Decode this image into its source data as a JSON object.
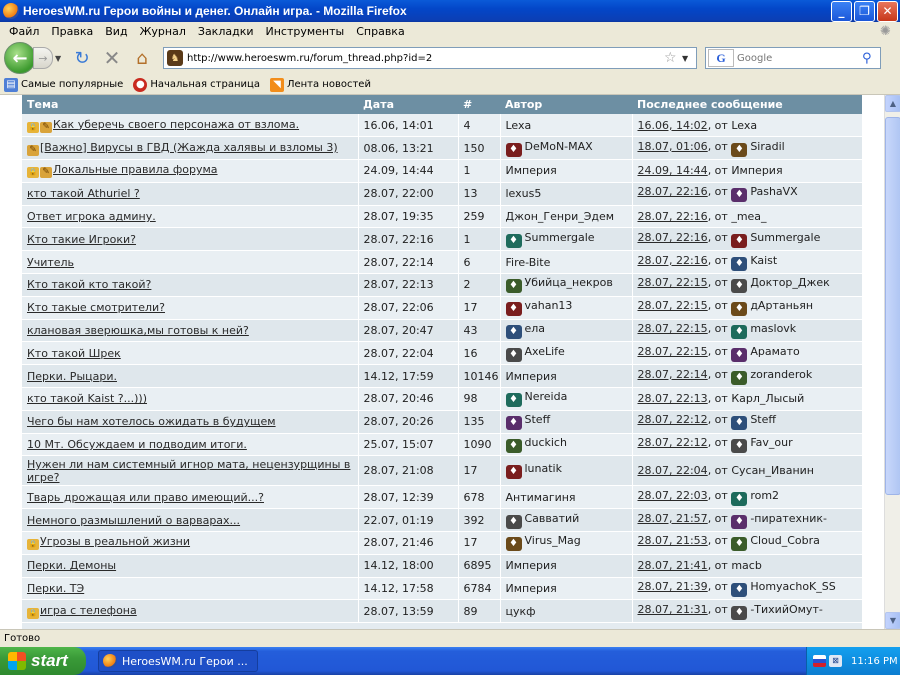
{
  "window": {
    "title": "HeroesWM.ru Герои войны и денег. Онлайн игра. - Mozilla Firefox",
    "minimize": "_",
    "maximize": "❐",
    "close": "✕"
  },
  "menu": [
    "Файл",
    "Правка",
    "Вид",
    "Журнал",
    "Закладки",
    "Инструменты",
    "Справка"
  ],
  "nav": {
    "url": "http://www.heroeswm.ru/forum_thread.php?id=2",
    "search_placeholder": "Google",
    "search_engine": "G"
  },
  "bookmarks": [
    "Самые популярные",
    "Начальная страница",
    "Лента новостей"
  ],
  "table": {
    "headers": [
      "Тема",
      "Дата",
      "#",
      "Автор",
      "Последнее сообщение"
    ],
    "rows": [
      {
        "topic": "Как уберечь своего персонажа от взлома.",
        "icon": "lock-pin",
        "date": "16.06, 14:01",
        "count": "4",
        "author": "Lexa",
        "author_icon": "",
        "last_date": "16.06, 14:02",
        "last_sep": ", от ",
        "last_author": "Lexa",
        "last_icon": ""
      },
      {
        "topic": "[Важно] Вирусы в ГВД (Жажда халявы и взломы 3)",
        "icon": "pin",
        "date": "08.06, 13:21",
        "count": "150",
        "author": "DeMoN-MAX",
        "author_icon": "clan",
        "last_date": "18.07, 01:06",
        "last_sep": ", от ",
        "last_author": "Siradil",
        "last_icon": "clan"
      },
      {
        "topic": "Локальные правила форума",
        "icon": "lock-pin",
        "date": "24.09, 14:44",
        "count": "1",
        "author": "Империя",
        "author_icon": "",
        "last_date": "24.09, 14:44",
        "last_sep": ", от ",
        "last_author": "Империя",
        "last_icon": ""
      },
      {
        "topic": "кто такой Athuriel ?",
        "icon": "",
        "date": "28.07, 22:00",
        "count": "13",
        "author": "lexus5",
        "author_icon": "",
        "last_date": "28.07, 22:16",
        "last_sep": ", от ",
        "last_author": "PashaVX",
        "last_icon": "clan"
      },
      {
        "topic": "Ответ игрока админу.",
        "icon": "",
        "date": "28.07, 19:35",
        "count": "259",
        "author": "Джон_Генри_Эдем",
        "author_icon": "",
        "last_date": "28.07, 22:16",
        "last_sep": ", от ",
        "last_author": "_mea_",
        "last_icon": ""
      },
      {
        "topic": "Кто такие Игроки?",
        "icon": "",
        "date": "28.07, 22:16",
        "count": "1",
        "author": "Summergale",
        "author_icon": "clan",
        "last_date": "28.07, 22:16",
        "last_sep": ", от ",
        "last_author": "Summergale",
        "last_icon": "clan"
      },
      {
        "topic": "Учитель",
        "icon": "",
        "date": "28.07, 22:14",
        "count": "6",
        "author": "Fire-Bite",
        "author_icon": "",
        "last_date": "28.07, 22:16",
        "last_sep": ", от ",
        "last_author": "Kaist",
        "last_icon": "clan"
      },
      {
        "topic": "Кто такой кто такой?",
        "icon": "",
        "date": "28.07, 22:13",
        "count": "2",
        "author": "Убийца_некров",
        "author_icon": "clan",
        "last_date": "28.07, 22:15",
        "last_sep": ", от ",
        "last_author": "Доктор_Джек",
        "last_icon": "clan"
      },
      {
        "topic": "Кто такые смотрители?",
        "icon": "",
        "date": "28.07, 22:06",
        "count": "17",
        "author": "vahan13",
        "author_icon": "clan",
        "last_date": "28.07, 22:15",
        "last_sep": ", от ",
        "last_author": "дАртаньян",
        "last_icon": "clan"
      },
      {
        "topic": "клановая зверюшка,мы готовы к ней?",
        "icon": "",
        "date": "28.07, 20:47",
        "count": "43",
        "author": "ела",
        "author_icon": "clan",
        "last_date": "28.07, 22:15",
        "last_sep": ", от ",
        "last_author": "maslovk",
        "last_icon": "clan"
      },
      {
        "topic": "Кто такой Шрек",
        "icon": "",
        "date": "28.07, 22:04",
        "count": "16",
        "author": "AxeLife",
        "author_icon": "clan",
        "last_date": "28.07, 22:15",
        "last_sep": ", от ",
        "last_author": "Арамато",
        "last_icon": "clan"
      },
      {
        "topic": "Перки. Рыцари.",
        "icon": "",
        "date": "14.12, 17:59",
        "count": "10146",
        "author": "Империя",
        "author_icon": "",
        "last_date": "28.07, 22:14",
        "last_sep": ", от ",
        "last_author": "zoranderok",
        "last_icon": "clan"
      },
      {
        "topic": "кто такой Kaist ?...)))",
        "icon": "",
        "date": "28.07, 20:46",
        "count": "98",
        "author": "Nereida",
        "author_icon": "clan",
        "last_date": "28.07, 22:13",
        "last_sep": ", от ",
        "last_author": "Карл_Лысый",
        "last_icon": ""
      },
      {
        "topic": "Чего бы нам хотелось ожидать в будущем",
        "icon": "",
        "date": "28.07, 20:26",
        "count": "135",
        "author": "Steff",
        "author_icon": "clan",
        "last_date": "28.07, 22:12",
        "last_sep": ", от ",
        "last_author": "Steff",
        "last_icon": "clan"
      },
      {
        "topic": "10 Мт. Обсуждаем и подводим итоги.",
        "icon": "",
        "date": "25.07, 15:07",
        "count": "1090",
        "author": "duckich",
        "author_icon": "clan",
        "last_date": "28.07, 22:12",
        "last_sep": ", от ",
        "last_author": "Fav_our",
        "last_icon": "clan"
      },
      {
        "topic": "Нужен ли нам системный игнор мата, нецензурщины в игре?",
        "icon": "",
        "date": "28.07, 21:08",
        "count": "17",
        "author": "lunatik",
        "author_icon": "clan",
        "last_date": "28.07, 22:04",
        "last_sep": ", от ",
        "last_author": "Сусан_Иванин",
        "last_icon": ""
      },
      {
        "topic": "Тварь дрожащая или право имеющий...?",
        "icon": "",
        "date": "28.07, 12:39",
        "count": "678",
        "author": "Антимагиня",
        "author_icon": "",
        "last_date": "28.07, 22:03",
        "last_sep": ", от ",
        "last_author": "rom2",
        "last_icon": "clan"
      },
      {
        "topic": "Немного размышлений о варварах...",
        "icon": "",
        "date": "22.07, 01:19",
        "count": "392",
        "author": "Савватий",
        "author_icon": "clan",
        "last_date": "28.07, 21:57",
        "last_sep": ", от ",
        "last_author": "-пиратехник-",
        "last_icon": "clan"
      },
      {
        "topic": "Угрозы в реальной жизни",
        "icon": "lock",
        "date": "28.07, 21:46",
        "count": "17",
        "author": "Virus_Mag",
        "author_icon": "clan",
        "last_date": "28.07, 21:53",
        "last_sep": ", от ",
        "last_author": "Cloud_Cobra",
        "last_icon": "clan"
      },
      {
        "topic": "Перки. Демоны",
        "icon": "",
        "date": "14.12, 18:00",
        "count": "6895",
        "author": "Империя",
        "author_icon": "",
        "last_date": "28.07, 21:41",
        "last_sep": ", от ",
        "last_author": "macb",
        "last_icon": ""
      },
      {
        "topic": "Перки. ТЭ",
        "icon": "",
        "date": "14.12, 17:58",
        "count": "6784",
        "author": "Империя",
        "author_icon": "",
        "last_date": "28.07, 21:39",
        "last_sep": ", от ",
        "last_author": "HomyachoK_SS",
        "last_icon": "clan"
      },
      {
        "topic": "игра с телефона",
        "icon": "lock",
        "date": "28.07, 13:59",
        "count": "89",
        "author": "цукф",
        "author_icon": "",
        "last_date": "28.07, 21:31",
        "last_sep": ", от ",
        "last_author": "-ТихийОмут-",
        "last_icon": "clan"
      }
    ]
  },
  "status": "Готово",
  "taskbar": {
    "start": "start",
    "item": "HeroesWM.ru Герои ...",
    "clock": "11:16 PM"
  },
  "colors": {
    "header_bg": "#6d8fa3",
    "row_odd": "#e9eff3",
    "row_even": "#dfe7ec",
    "taskbar": "#245edb",
    "start": "#3a9a38"
  }
}
